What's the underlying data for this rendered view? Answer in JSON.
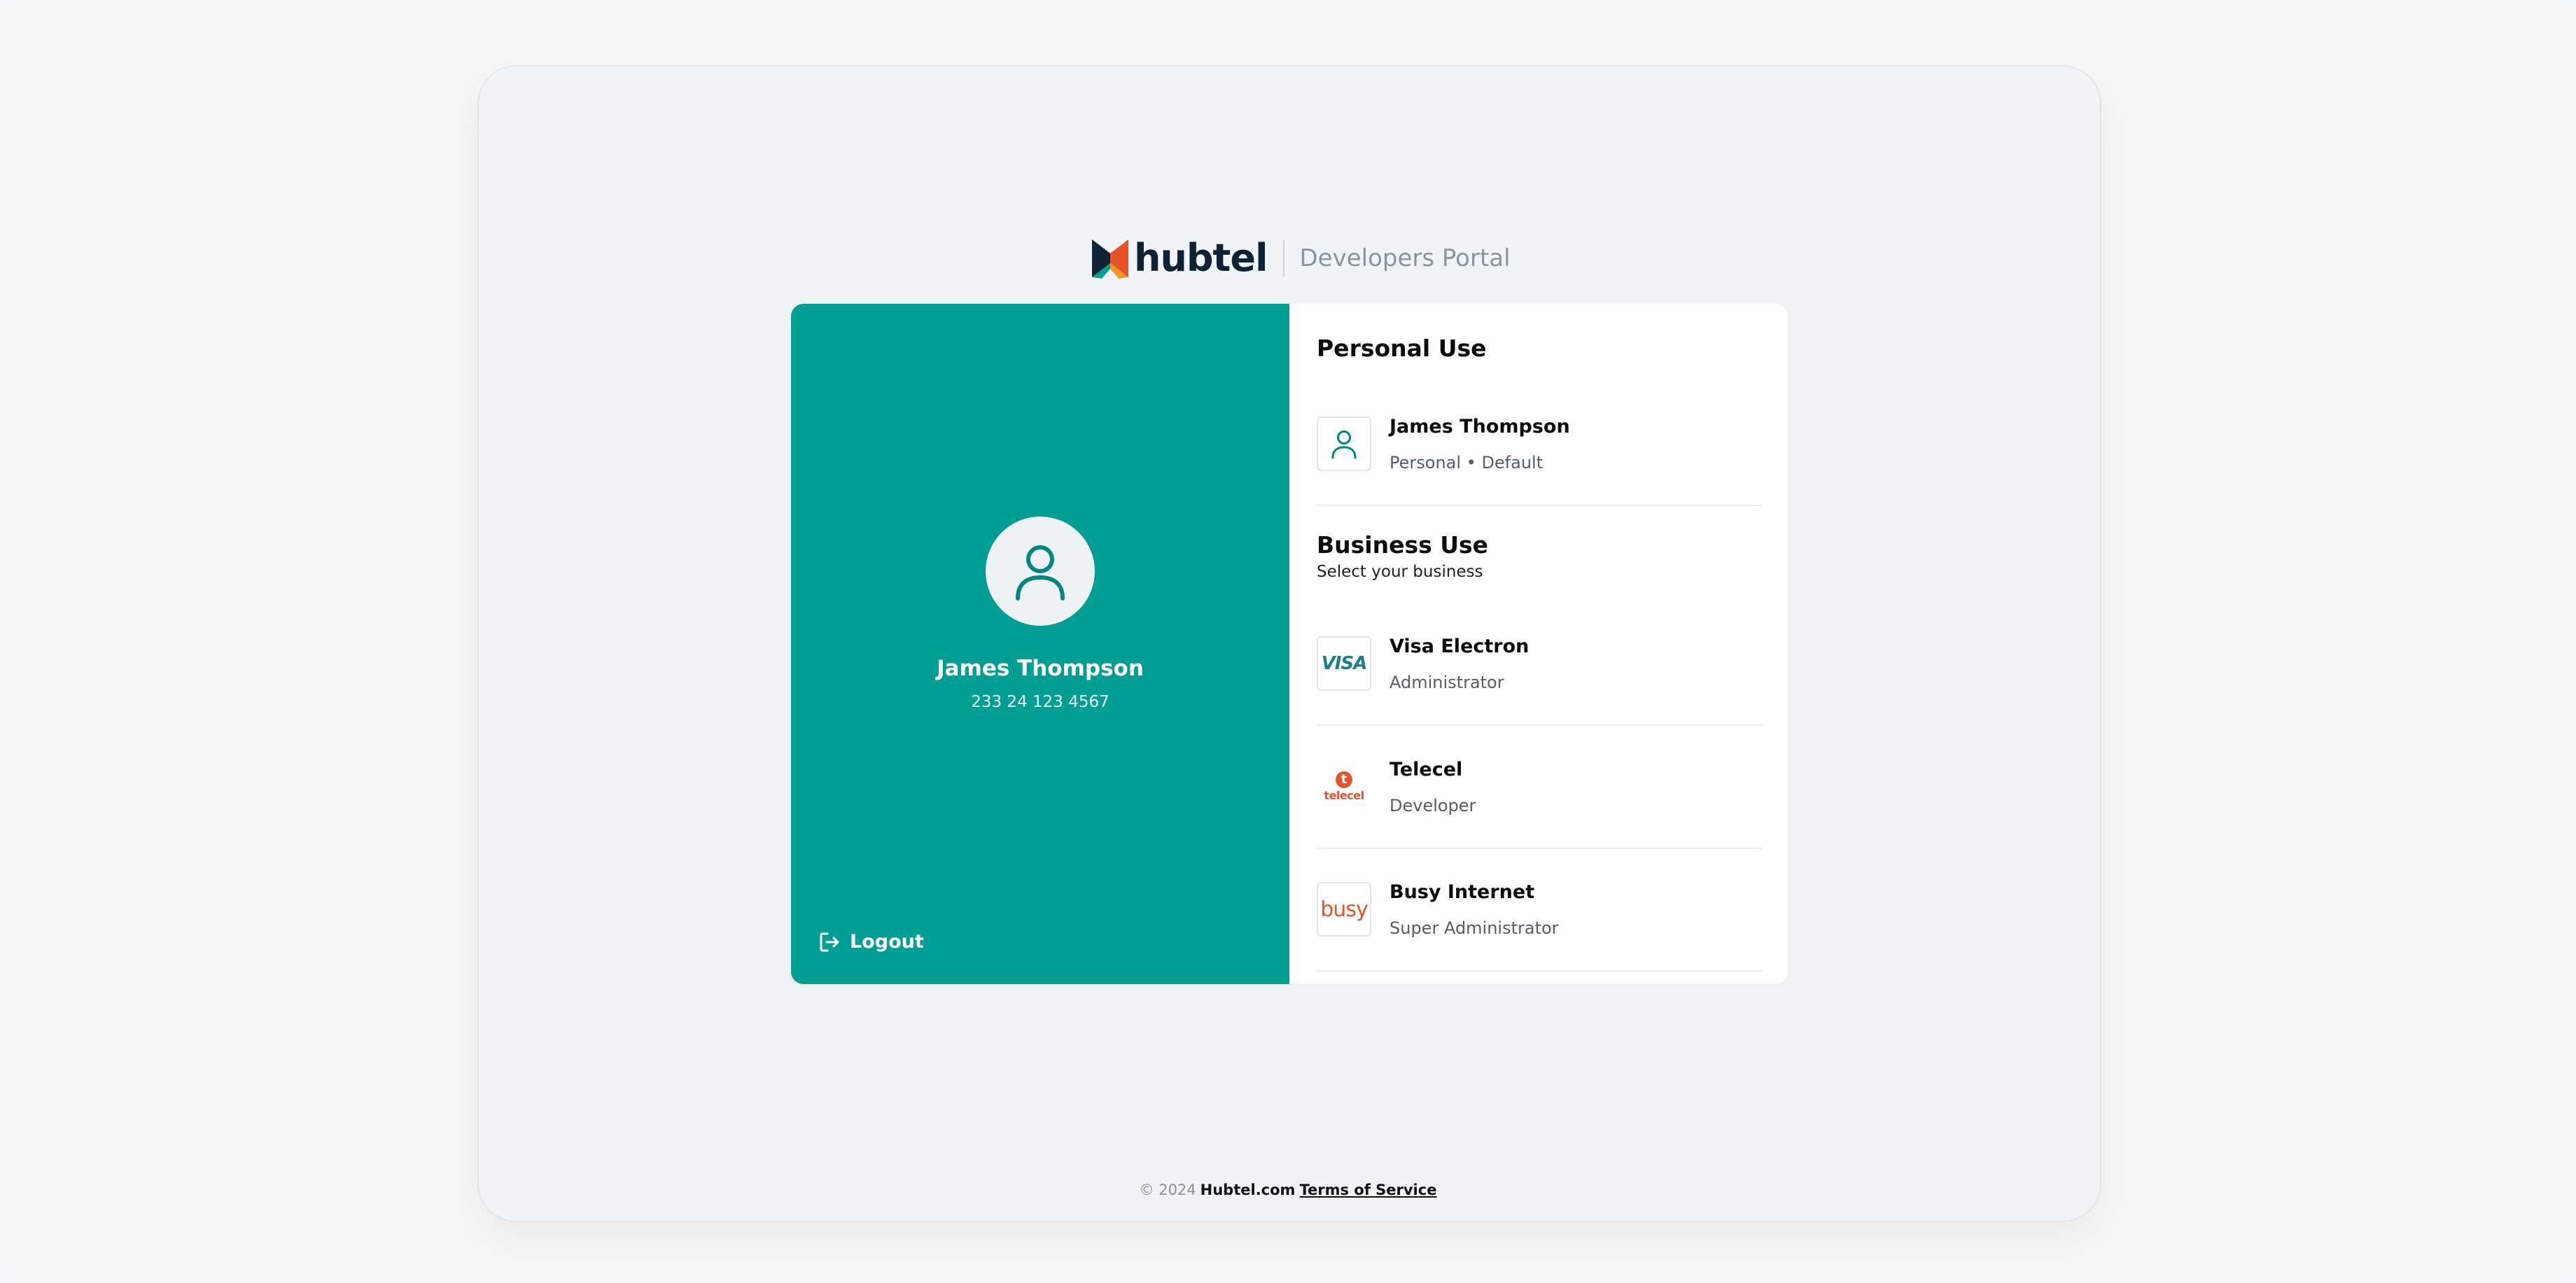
{
  "header": {
    "brand": "hubtel",
    "portal": "Developers Portal"
  },
  "profile": {
    "name": "James Thompson",
    "phone": "233 24 123 4567",
    "logout_label": "Logout"
  },
  "personal": {
    "title": "Personal Use",
    "items": [
      {
        "name": "James Thompson",
        "role": "Personal • Default",
        "icon": "user-icon"
      }
    ]
  },
  "business": {
    "title": "Business Use",
    "subtitle": "Select your business",
    "items": [
      {
        "name": "Visa Electron",
        "role": "Administrator",
        "logo_text": "VISA",
        "icon": "visa-logo"
      },
      {
        "name": "Telecel",
        "role": "Developer",
        "logo_text": "telecel",
        "logo_glyph": "t",
        "icon": "telecel-logo"
      },
      {
        "name": "Busy Internet",
        "role": "Super Administrator",
        "logo_text": "busy",
        "icon": "busy-logo"
      }
    ]
  },
  "footer": {
    "copyright": "© 2024",
    "site": "Hubtel.com",
    "terms": "Terms of Service"
  },
  "colors": {
    "brand_teal": "#019e94",
    "accent_orange": "#e2542d",
    "logo_navy": "#0f2233"
  }
}
